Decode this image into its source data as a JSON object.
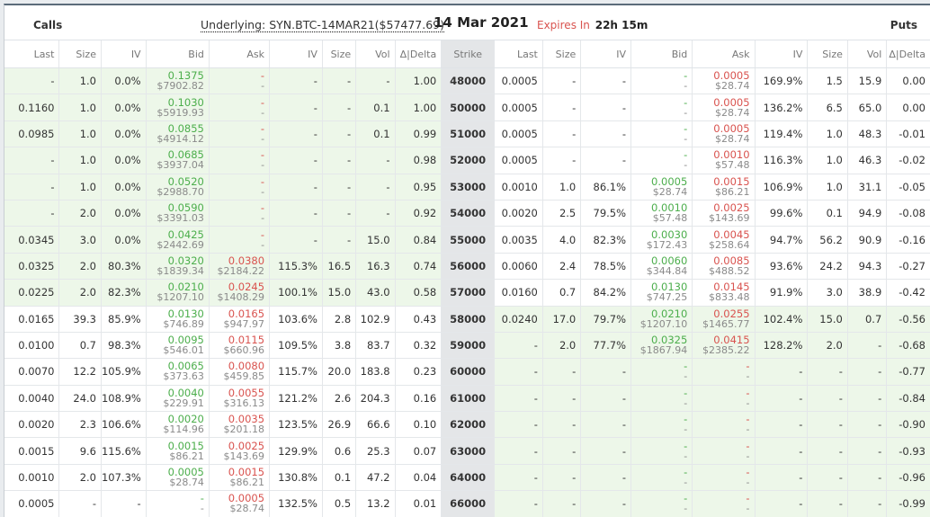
{
  "header": {
    "calls_label": "Calls",
    "puts_label": "Puts",
    "underlying": "Underlying: SYN.BTC-14MAR21($57477.69)",
    "date": "14 Mar 2021",
    "expires_label": "Expires In",
    "expires_value": "22h 15m"
  },
  "columns": {
    "calls": [
      "Last",
      "Size",
      "IV",
      "Bid",
      "Ask",
      "IV",
      "Size",
      "Vol",
      "Δ|Delta"
    ],
    "strike": "Strike",
    "puts": [
      "Last",
      "Size",
      "IV",
      "Bid",
      "Ask",
      "IV",
      "Size",
      "Vol",
      "Δ|Delta"
    ]
  },
  "rows": [
    {
      "strike": "48000",
      "c_itm": true,
      "p_itm": false,
      "c": [
        "-",
        "1.0",
        "0.0%",
        [
          "0.1375",
          "$7902.82"
        ],
        [
          "-",
          "-"
        ],
        "-",
        "-",
        "-",
        "1.00"
      ],
      "p": [
        "0.0005",
        "-",
        "-",
        [
          "-",
          "-"
        ],
        [
          "0.0005",
          "$28.74"
        ],
        "169.9%",
        "1.5",
        "15.9",
        "0.00"
      ]
    },
    {
      "strike": "50000",
      "c_itm": true,
      "p_itm": false,
      "c": [
        "0.1160",
        "1.0",
        "0.0%",
        [
          "0.1030",
          "$5919.93"
        ],
        [
          "-",
          "-"
        ],
        "-",
        "-",
        "0.1",
        "1.00"
      ],
      "p": [
        "0.0005",
        "-",
        "-",
        [
          "-",
          "-"
        ],
        [
          "0.0005",
          "$28.74"
        ],
        "136.2%",
        "6.5",
        "65.0",
        "0.00"
      ]
    },
    {
      "strike": "51000",
      "c_itm": true,
      "p_itm": false,
      "c": [
        "0.0985",
        "1.0",
        "0.0%",
        [
          "0.0855",
          "$4914.12"
        ],
        [
          "-",
          "-"
        ],
        "-",
        "-",
        "0.1",
        "0.99"
      ],
      "p": [
        "0.0005",
        "-",
        "-",
        [
          "-",
          "-"
        ],
        [
          "0.0005",
          "$28.74"
        ],
        "119.4%",
        "1.0",
        "48.3",
        "-0.01"
      ]
    },
    {
      "strike": "52000",
      "c_itm": true,
      "p_itm": false,
      "c": [
        "-",
        "1.0",
        "0.0%",
        [
          "0.0685",
          "$3937.04"
        ],
        [
          "-",
          "-"
        ],
        "-",
        "-",
        "-",
        "0.98"
      ],
      "p": [
        "0.0005",
        "-",
        "-",
        [
          "-",
          "-"
        ],
        [
          "0.0010",
          "$57.48"
        ],
        "116.3%",
        "1.0",
        "46.3",
        "-0.02"
      ]
    },
    {
      "strike": "53000",
      "c_itm": true,
      "p_itm": false,
      "c": [
        "-",
        "1.0",
        "0.0%",
        [
          "0.0520",
          "$2988.70"
        ],
        [
          "-",
          "-"
        ],
        "-",
        "-",
        "-",
        "0.95"
      ],
      "p": [
        "0.0010",
        "1.0",
        "86.1%",
        [
          "0.0005",
          "$28.74"
        ],
        [
          "0.0015",
          "$86.21"
        ],
        "106.9%",
        "1.0",
        "31.1",
        "-0.05"
      ]
    },
    {
      "strike": "54000",
      "c_itm": true,
      "p_itm": false,
      "c": [
        "-",
        "2.0",
        "0.0%",
        [
          "0.0590",
          "$3391.03"
        ],
        [
          "-",
          "-"
        ],
        "-",
        "-",
        "-",
        "0.92"
      ],
      "p": [
        "0.0020",
        "2.5",
        "79.5%",
        [
          "0.0010",
          "$57.48"
        ],
        [
          "0.0025",
          "$143.69"
        ],
        "99.6%",
        "0.1",
        "94.9",
        "-0.08"
      ]
    },
    {
      "strike": "55000",
      "c_itm": true,
      "p_itm": false,
      "c": [
        "0.0345",
        "3.0",
        "0.0%",
        [
          "0.0425",
          "$2442.69"
        ],
        [
          "-",
          "-"
        ],
        "-",
        "-",
        "15.0",
        "0.84"
      ],
      "p": [
        "0.0035",
        "4.0",
        "82.3%",
        [
          "0.0030",
          "$172.43"
        ],
        [
          "0.0045",
          "$258.64"
        ],
        "94.7%",
        "56.2",
        "90.9",
        "-0.16"
      ]
    },
    {
      "strike": "56000",
      "c_itm": true,
      "p_itm": false,
      "c": [
        "0.0325",
        "2.0",
        "80.3%",
        [
          "0.0320",
          "$1839.34"
        ],
        [
          "0.0380",
          "$2184.22"
        ],
        "115.3%",
        "16.5",
        "16.3",
        "0.74"
      ],
      "p": [
        "0.0060",
        "2.4",
        "78.5%",
        [
          "0.0060",
          "$344.84"
        ],
        [
          "0.0085",
          "$488.52"
        ],
        "93.6%",
        "24.2",
        "94.3",
        "-0.27"
      ]
    },
    {
      "strike": "57000",
      "c_itm": true,
      "p_itm": false,
      "c": [
        "0.0225",
        "2.0",
        "82.3%",
        [
          "0.0210",
          "$1207.10"
        ],
        [
          "0.0245",
          "$1408.29"
        ],
        "100.1%",
        "15.0",
        "43.0",
        "0.58"
      ],
      "p": [
        "0.0160",
        "0.7",
        "84.2%",
        [
          "0.0130",
          "$747.25"
        ],
        [
          "0.0145",
          "$833.48"
        ],
        "91.9%",
        "3.0",
        "38.9",
        "-0.42"
      ]
    },
    {
      "strike": "58000",
      "c_itm": false,
      "p_itm": true,
      "c": [
        "0.0165",
        "39.3",
        "85.9%",
        [
          "0.0130",
          "$746.89"
        ],
        [
          "0.0165",
          "$947.97"
        ],
        "103.6%",
        "2.8",
        "102.9",
        "0.43"
      ],
      "p": [
        "0.0240",
        "17.0",
        "79.7%",
        [
          "0.0210",
          "$1207.10"
        ],
        [
          "0.0255",
          "$1465.77"
        ],
        "102.4%",
        "15.0",
        "0.7",
        "-0.56"
      ]
    },
    {
      "strike": "59000",
      "c_itm": false,
      "p_itm": true,
      "c": [
        "0.0100",
        "0.7",
        "98.3%",
        [
          "0.0095",
          "$546.01"
        ],
        [
          "0.0115",
          "$660.96"
        ],
        "109.5%",
        "3.8",
        "83.7",
        "0.32"
      ],
      "p": [
        "-",
        "2.0",
        "77.7%",
        [
          "0.0325",
          "$1867.94"
        ],
        [
          "0.0415",
          "$2385.22"
        ],
        "128.2%",
        "2.0",
        "-",
        "-0.68"
      ]
    },
    {
      "strike": "60000",
      "c_itm": false,
      "p_itm": true,
      "c": [
        "0.0070",
        "12.2",
        "105.9%",
        [
          "0.0065",
          "$373.63"
        ],
        [
          "0.0080",
          "$459.85"
        ],
        "115.7%",
        "20.0",
        "183.8",
        "0.23"
      ],
      "p": [
        "-",
        "-",
        "-",
        [
          "-",
          "-"
        ],
        [
          "-",
          "-"
        ],
        "-",
        "-",
        "-",
        "-0.77"
      ]
    },
    {
      "strike": "61000",
      "c_itm": false,
      "p_itm": true,
      "c": [
        "0.0040",
        "24.0",
        "108.9%",
        [
          "0.0040",
          "$229.91"
        ],
        [
          "0.0055",
          "$316.13"
        ],
        "121.2%",
        "2.6",
        "204.3",
        "0.16"
      ],
      "p": [
        "-",
        "-",
        "-",
        [
          "-",
          "-"
        ],
        [
          "-",
          "-"
        ],
        "-",
        "-",
        "-",
        "-0.84"
      ]
    },
    {
      "strike": "62000",
      "c_itm": false,
      "p_itm": true,
      "c": [
        "0.0020",
        "2.3",
        "106.6%",
        [
          "0.0020",
          "$114.96"
        ],
        [
          "0.0035",
          "$201.18"
        ],
        "123.5%",
        "26.9",
        "66.6",
        "0.10"
      ],
      "p": [
        "-",
        "-",
        "-",
        [
          "-",
          "-"
        ],
        [
          "-",
          "-"
        ],
        "-",
        "-",
        "-",
        "-0.90"
      ]
    },
    {
      "strike": "63000",
      "c_itm": false,
      "p_itm": true,
      "c": [
        "0.0015",
        "9.6",
        "115.6%",
        [
          "0.0015",
          "$86.21"
        ],
        [
          "0.0025",
          "$143.69"
        ],
        "129.9%",
        "0.6",
        "25.3",
        "0.07"
      ],
      "p": [
        "-",
        "-",
        "-",
        [
          "-",
          "-"
        ],
        [
          "-",
          "-"
        ],
        "-",
        "-",
        "-",
        "-0.93"
      ]
    },
    {
      "strike": "64000",
      "c_itm": false,
      "p_itm": true,
      "c": [
        "0.0010",
        "2.0",
        "107.3%",
        [
          "0.0005",
          "$28.74"
        ],
        [
          "0.0015",
          "$86.21"
        ],
        "130.8%",
        "0.1",
        "47.2",
        "0.04"
      ],
      "p": [
        "-",
        "-",
        "-",
        [
          "-",
          "-"
        ],
        [
          "-",
          "-"
        ],
        "-",
        "-",
        "-",
        "-0.96"
      ]
    },
    {
      "strike": "66000",
      "c_itm": false,
      "p_itm": true,
      "c": [
        "0.0005",
        "-",
        "-",
        [
          "-",
          "-"
        ],
        [
          "0.0005",
          "$28.74"
        ],
        "132.5%",
        "0.5",
        "13.2",
        "0.01"
      ],
      "p": [
        "-",
        "-",
        "-",
        [
          "-",
          "-"
        ],
        [
          "-",
          "-"
        ],
        "-",
        "-",
        "-",
        "-0.99"
      ]
    }
  ]
}
